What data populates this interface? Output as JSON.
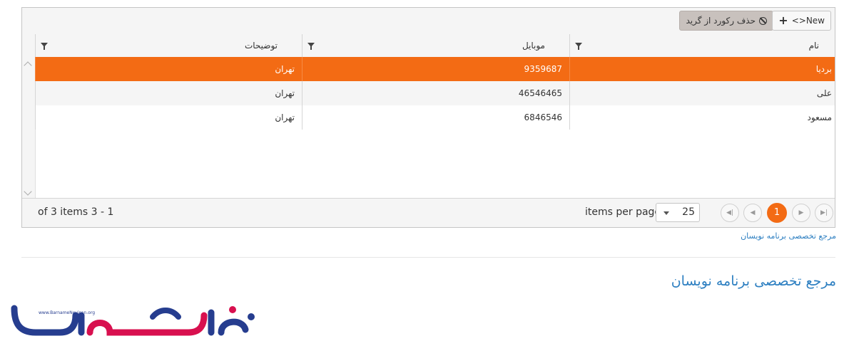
{
  "toolbar": {
    "new_label": "<>New",
    "delete_label": "حذف رکورد از گرید"
  },
  "columns": [
    {
      "title": "نام"
    },
    {
      "title": "موبایل"
    },
    {
      "title": "توضیحات"
    }
  ],
  "rows": [
    {
      "name": "بردیا",
      "mobile": "9359687",
      "description": "تهران",
      "selected": true
    },
    {
      "name": "علی",
      "mobile": "46546465",
      "description": "تهران",
      "selected": false
    },
    {
      "name": "مسعود",
      "mobile": "6846546",
      "description": "تهران",
      "selected": false
    }
  ],
  "pager": {
    "info": "of 3 items 3 - 1",
    "items_per_page_label": "items per page",
    "page_size": "25",
    "current_page": "1"
  },
  "footer": {
    "link_text": "مرجع تخصصی برنامه نویسان",
    "heading": "مرجع تخصصی برنامه نویسان",
    "logo_url_text": "www.BarnameNevisan.org"
  },
  "colors": {
    "accent": "#f36b14",
    "link": "#2d7fc1",
    "logo_blue": "#263d8f",
    "logo_red": "#d8104f"
  }
}
